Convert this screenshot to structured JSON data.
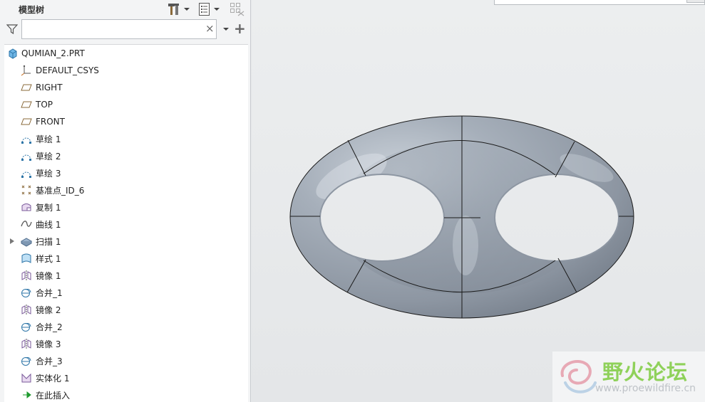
{
  "model_tree": {
    "title": "模型树",
    "search": {
      "value": "",
      "placeholder": ""
    },
    "clear_glyph": "×",
    "add_glyph": "+",
    "items": [
      {
        "label": "QUMIAN_2.PRT",
        "icon": "part-icon",
        "indent": 0
      },
      {
        "label": "DEFAULT_CSYS",
        "icon": "csys-icon",
        "indent": 1
      },
      {
        "label": "RIGHT",
        "icon": "datum-plane-icon",
        "indent": 1
      },
      {
        "label": "TOP",
        "icon": "datum-plane-icon",
        "indent": 1
      },
      {
        "label": "FRONT",
        "icon": "datum-plane-icon",
        "indent": 1
      },
      {
        "label": "草绘 1",
        "icon": "sketch-icon",
        "indent": 1
      },
      {
        "label": "草绘 2",
        "icon": "sketch-icon",
        "indent": 1
      },
      {
        "label": "草绘 3",
        "icon": "sketch-icon",
        "indent": 1
      },
      {
        "label": "基准点_ID_6",
        "icon": "datum-point-icon",
        "indent": 1
      },
      {
        "label": "复制 1",
        "icon": "copy-surface-icon",
        "indent": 1
      },
      {
        "label": "曲线 1",
        "icon": "curve-icon",
        "indent": 1
      },
      {
        "label": "扫描 1",
        "icon": "sweep-icon",
        "indent": 1,
        "expandable": true
      },
      {
        "label": "样式 1",
        "icon": "style-icon",
        "indent": 1
      },
      {
        "label": "镜像 1",
        "icon": "mirror-icon",
        "indent": 1
      },
      {
        "label": "合并_1",
        "icon": "merge-icon",
        "indent": 1
      },
      {
        "label": "镜像 2",
        "icon": "mirror-icon",
        "indent": 1
      },
      {
        "label": "合并_2",
        "icon": "merge-icon",
        "indent": 1
      },
      {
        "label": "镜像 3",
        "icon": "mirror-icon",
        "indent": 1
      },
      {
        "label": "合并_3",
        "icon": "merge-icon",
        "indent": 1
      },
      {
        "label": "实体化 1",
        "icon": "solidify-icon",
        "indent": 1
      },
      {
        "label": "在此插入",
        "icon": "insert-here-arrow-icon",
        "indent": 1
      }
    ]
  },
  "watermark": {
    "brand": "野火论坛",
    "url": "www.proewildfire.cn"
  },
  "colors": {
    "model_surface": "#9aa3ae",
    "model_edge": "#1a1a1a",
    "viewport_bg": "#e6e8ea",
    "insert_arrow": "#1f9a2e",
    "watermark_green": "#8fd15a"
  }
}
